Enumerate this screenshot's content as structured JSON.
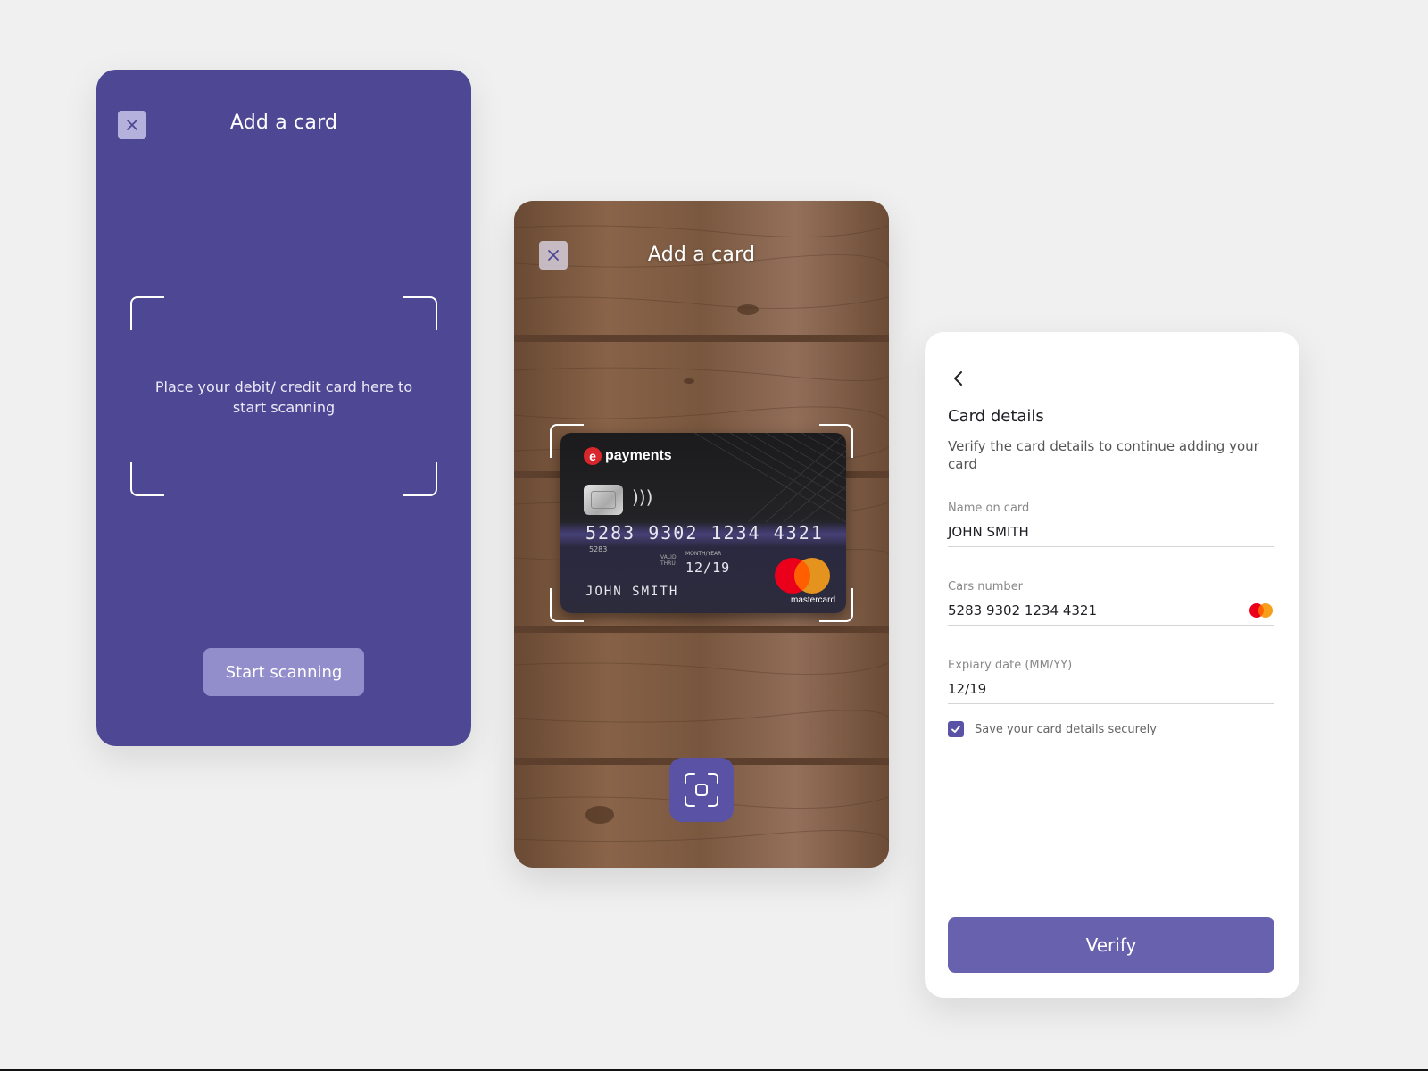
{
  "colors": {
    "background": "#f0f0f0",
    "primary_purple": "#4e4894",
    "button_purple": "#6862ae",
    "start_button": "#928dcb",
    "card_dark": "#1b1b1d",
    "mastercard_red": "#eb001b",
    "mastercard_orange": "#f79e1b"
  },
  "panel1": {
    "title": "Add a card",
    "close_icon": "close-icon",
    "scan_hint": "Place your debit/ credit card here to start scanning",
    "start_button": "Start scanning"
  },
  "panel2": {
    "title": "Add a card",
    "close_icon": "close-icon",
    "card": {
      "brand": "payments",
      "brand_mark": "e",
      "number": "5283 9302 1234 4321",
      "number_sub": "5283",
      "valid_label_1": "VALID",
      "valid_label_2": "THRU",
      "month_year_label": "MONTH/YEAR",
      "expiry": "12/19",
      "holder": "JOHN SMITH",
      "network": "mastercard"
    },
    "shutter_icon": "scan-focus-icon"
  },
  "panel3": {
    "back_icon": "chevron-left-icon",
    "title": "Card details",
    "subtitle": "Verify the card details to continue adding your card",
    "fields": [
      {
        "label": "Name on card",
        "value": "JOHN SMITH"
      },
      {
        "label": "Cars number",
        "value": "5283 9302 1234 4321"
      },
      {
        "label": "Expiary date (MM/YY)",
        "value": "12/19"
      }
    ],
    "save_checkbox": {
      "checked": true,
      "label": "Save your card details securely"
    },
    "verify_button": "Verify"
  }
}
